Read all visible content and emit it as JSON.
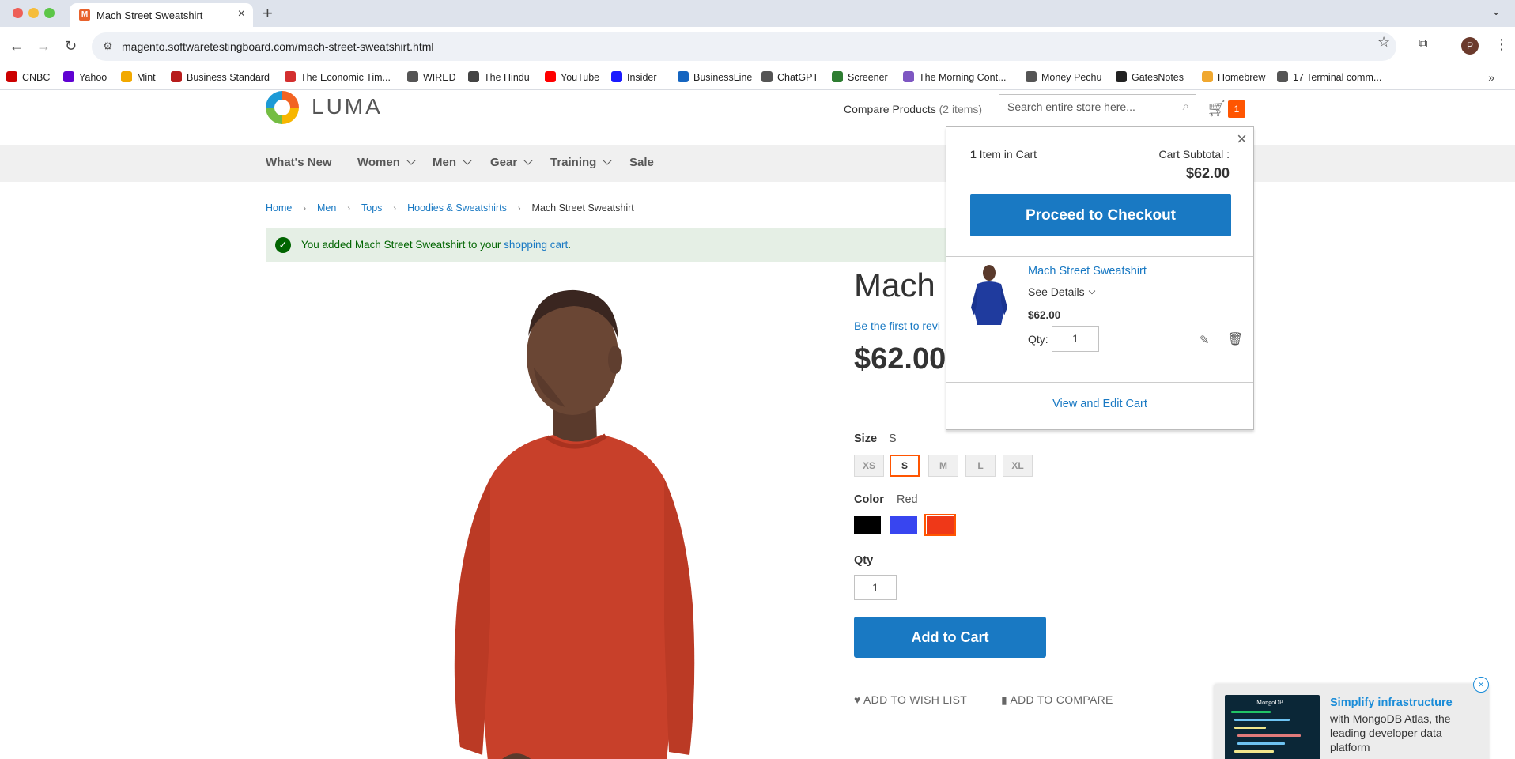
{
  "browser": {
    "tab_title": "Mach Street Sweatshirt",
    "url": "magento.softwaretestingboard.com/mach-street-sweatshirt.html",
    "profile_initial": "P",
    "bookmarks": [
      {
        "label": "CNBC",
        "color": "#cc0000"
      },
      {
        "label": "Yahoo",
        "color": "#6001d2"
      },
      {
        "label": "Mint",
        "color": "#f2a900"
      },
      {
        "label": "Business Standard",
        "color": "#b71c1c"
      },
      {
        "label": "The Economic Tim...",
        "color": "#d32f2f"
      },
      {
        "label": "WIRED",
        "color": "#555555"
      },
      {
        "label": "The Hindu",
        "color": "#444444"
      },
      {
        "label": "YouTube",
        "color": "#ff0000"
      },
      {
        "label": "Insider",
        "color": "#1a1aff"
      },
      {
        "label": "BusinessLine",
        "color": "#1565c0"
      },
      {
        "label": "ChatGPT",
        "color": "#555555"
      },
      {
        "label": "Screener",
        "color": "#2e7d32"
      },
      {
        "label": "The Morning Cont...",
        "color": "#7e57c2"
      },
      {
        "label": "Money Pechu",
        "color": "#555555"
      },
      {
        "label": "GatesNotes",
        "color": "#222222"
      },
      {
        "label": "Homebrew",
        "color": "#f0a830"
      },
      {
        "label": "17 Terminal comm...",
        "color": "#555555"
      }
    ]
  },
  "header": {
    "logo_text": "LUMA",
    "compare_label": "Compare Products",
    "compare_count": "(2 items)",
    "search_placeholder": "Search entire store here...",
    "cart_count": "1"
  },
  "nav": {
    "items": [
      "What's New",
      "Women",
      "Men",
      "Gear",
      "Training",
      "Sale"
    ]
  },
  "breadcrumb": {
    "items": [
      "Home",
      "Men",
      "Tops",
      "Hoodies & Sweatshirts"
    ],
    "current": "Mach Street Sweatshirt"
  },
  "message": {
    "text_before": "You added Mach Street Sweatshirt to your ",
    "link": "shopping cart",
    "text_after": "."
  },
  "product": {
    "title_visible": "Mach S",
    "review_visible": "Be the first to revi",
    "price": "$62.00",
    "size_label": "Size",
    "size_selected": "S",
    "sizes": [
      "XS",
      "S",
      "M",
      "L",
      "XL"
    ],
    "color_label": "Color",
    "color_selected": "Red",
    "colors": [
      {
        "name": "Black",
        "hex": "#000000"
      },
      {
        "name": "Blue",
        "hex": "#3845f0"
      },
      {
        "name": "Red",
        "hex": "#ef3818"
      }
    ],
    "qty_label": "Qty",
    "qty_value": "1",
    "add_to_cart": "Add to Cart",
    "wishlist": "Add to Wish List",
    "compare": "Add to Compare"
  },
  "minicart": {
    "count_number": "1",
    "count_text": " Item in Cart",
    "subtotal_label": "Cart Subtotal :",
    "subtotal_value": "$62.00",
    "checkout": "Proceed to Checkout",
    "item_name": "Mach Street Sweatshirt",
    "see_details": "See Details",
    "item_price": "$62.00",
    "qty_label": "Qty:",
    "qty_value": "1",
    "view_edit": "View and Edit Cart"
  },
  "ad": {
    "title": "Simplify infrastructure",
    "body": "with MongoDB Atlas, the leading developer data platform",
    "brand": "MongoDB"
  },
  "colors": {
    "accent": "#1979c3",
    "orange": "#ff5501",
    "success_bg": "#e5efe5",
    "success_text": "#006400"
  }
}
